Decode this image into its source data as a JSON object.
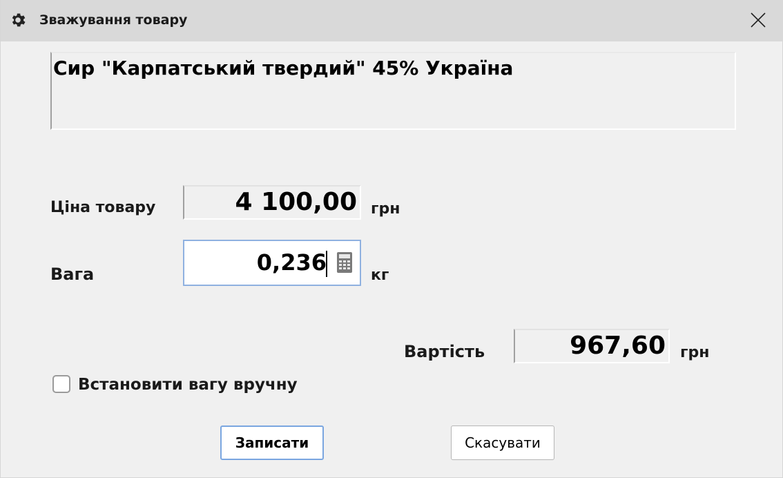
{
  "window": {
    "title": "Зважування товару",
    "title_icon": "gear-icon",
    "close_icon": "close-icon"
  },
  "product": {
    "name": "Сир \"Карпатський твердий\" 45% Україна"
  },
  "price": {
    "label": "Ціна товару",
    "value": "4 100,00",
    "unit": "грн"
  },
  "weight": {
    "label": "Вага",
    "value": "0,236",
    "unit": "кг",
    "icon": "calculator-icon"
  },
  "total": {
    "label": "Вартість",
    "value": "967,60",
    "unit": "грн"
  },
  "manual_weight": {
    "label": "Встановити вагу вручну",
    "checked": false
  },
  "buttons": {
    "ok_label": "Записати",
    "cancel_label": "Скасувати"
  },
  "colors": {
    "titlebar_bg": "#d9d9d9",
    "window_bg": "#f0f0f0",
    "focus_border": "#8fb1e0",
    "default_button_border": "#7aa6e0"
  }
}
